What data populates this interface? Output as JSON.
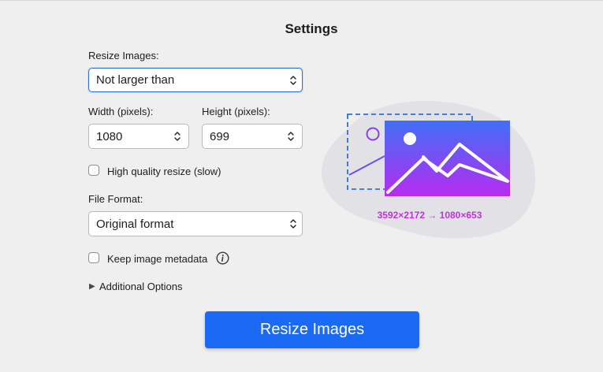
{
  "header": {
    "title": "Settings"
  },
  "resize": {
    "label": "Resize Images:",
    "mode_value": "Not larger than"
  },
  "dimensions": {
    "width_label": "Width (pixels):",
    "width_value": "1080",
    "height_label": "Height (pixels):",
    "height_value": "699"
  },
  "options": {
    "high_quality_label": "High quality resize (slow)",
    "high_quality_checked": false,
    "metadata_label": "Keep image metadata",
    "metadata_checked": false,
    "additional_label": "Additional Options"
  },
  "format": {
    "label": "File Format:",
    "value": "Original format"
  },
  "preview": {
    "caption": "3592×2172 → 1080×653",
    "gradient_top": "#3f6ff6",
    "gradient_bottom": "#b72cf0",
    "blob_color": "#e2e2e6",
    "selection_color": "#2f6fd9"
  },
  "action": {
    "primary_label": "Resize Images",
    "primary_color": "#1a6af5"
  },
  "icons": {
    "select_chevron": "chevron-up-down-icon",
    "info": "info-icon",
    "disclosure": "disclosure-triangle-icon"
  }
}
